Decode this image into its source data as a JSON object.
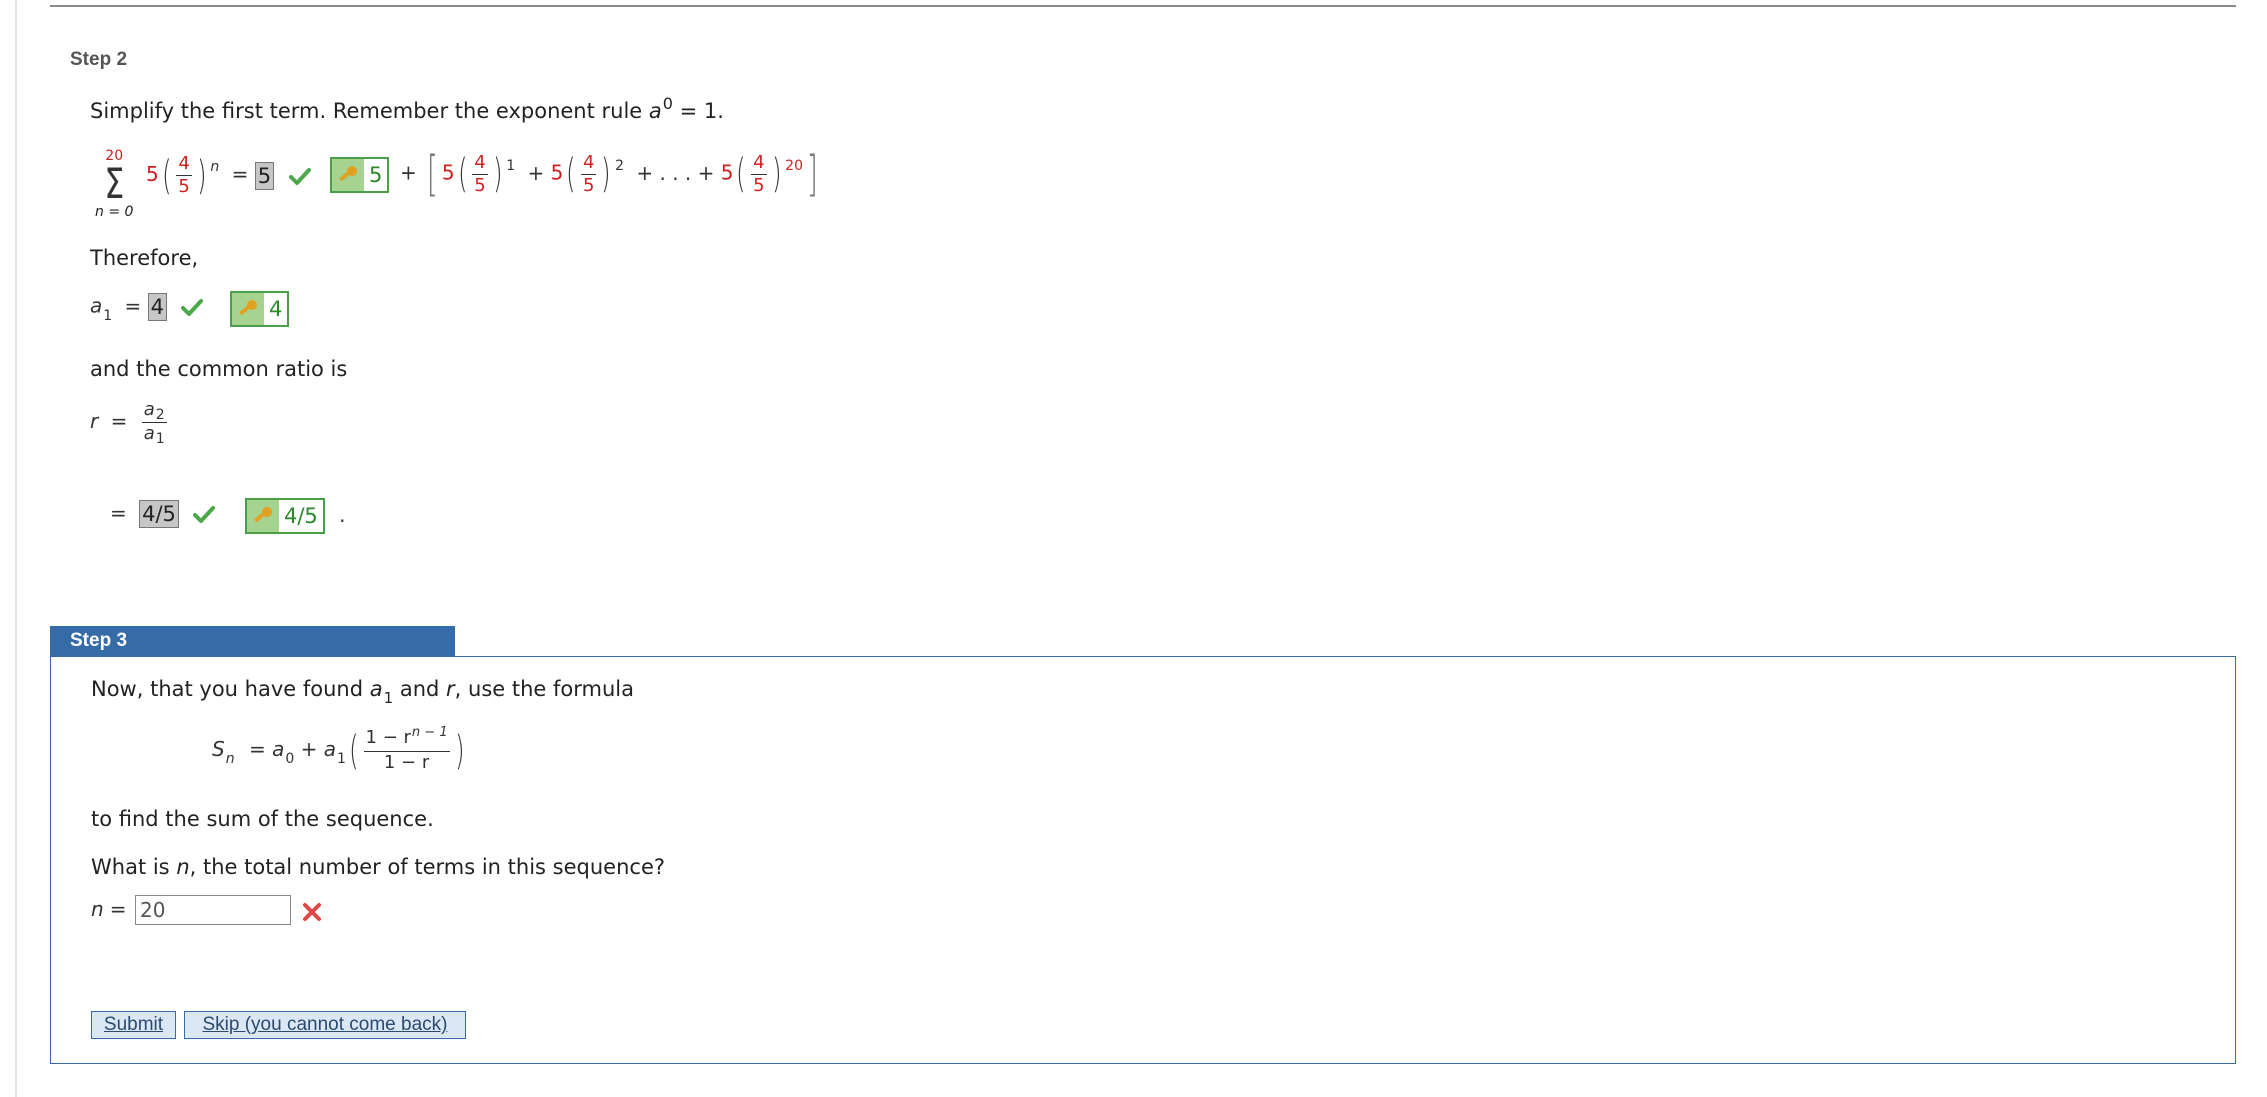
{
  "step2": {
    "label": "Step 2",
    "instruction_prefix": "Simplify the first term. Remember the exponent rule ",
    "instruction_base": "a",
    "instruction_exp": "0",
    "instruction_suffix": " = 1.",
    "sum_upper": "20",
    "sum_lower": "n = 0",
    "coef": "5",
    "frac_num": "4",
    "frac_den": "5",
    "exp_n": "n",
    "first_term_answer": "5",
    "first_term_key": "5",
    "plus": "+",
    "exp_1": "1",
    "exp_2": "2",
    "dots": "+ . . . +",
    "exp_20": "20",
    "therefore": "Therefore,",
    "a1_base": "a",
    "a1_sub": "1",
    "a1_answer": "4",
    "a1_key": "4",
    "common_ratio_text": "and the common ratio is",
    "r_label": "r",
    "r_num_base": "a",
    "r_num_sub": "2",
    "r_den_base": "a",
    "r_den_sub": "1",
    "r_answer": "4/5",
    "r_key": "4/5",
    "period": "."
  },
  "step3": {
    "label": "Step 3",
    "intro_a": "Now, that you have found ",
    "intro_a1_base": "a",
    "intro_a1_sub": "1",
    "intro_and": " and ",
    "intro_r": "r",
    "intro_rest": ", use the formula",
    "formula": {
      "S": "S",
      "S_sub": "n",
      "eq": "= ",
      "a0_base": "a",
      "a0_sub": "0",
      "plus": " + ",
      "a1_base": "a",
      "a1_sub": "1",
      "num": "1 − r",
      "num_exp": "n − 1",
      "den": "1 − r"
    },
    "find_sum": "to find the sum of the sequence.",
    "question_a": "What is ",
    "question_n": "n",
    "question_b": ", the total number of terms in this sequence?",
    "n_label": "n",
    "n_value": "20",
    "submit_label": "Submit",
    "skip_label": "Skip (you cannot come back)"
  },
  "colors": {
    "accent": "#356ca7",
    "correct": "#2a8a2a",
    "wrong": "#e04848",
    "highlight_red": "#d22020"
  }
}
